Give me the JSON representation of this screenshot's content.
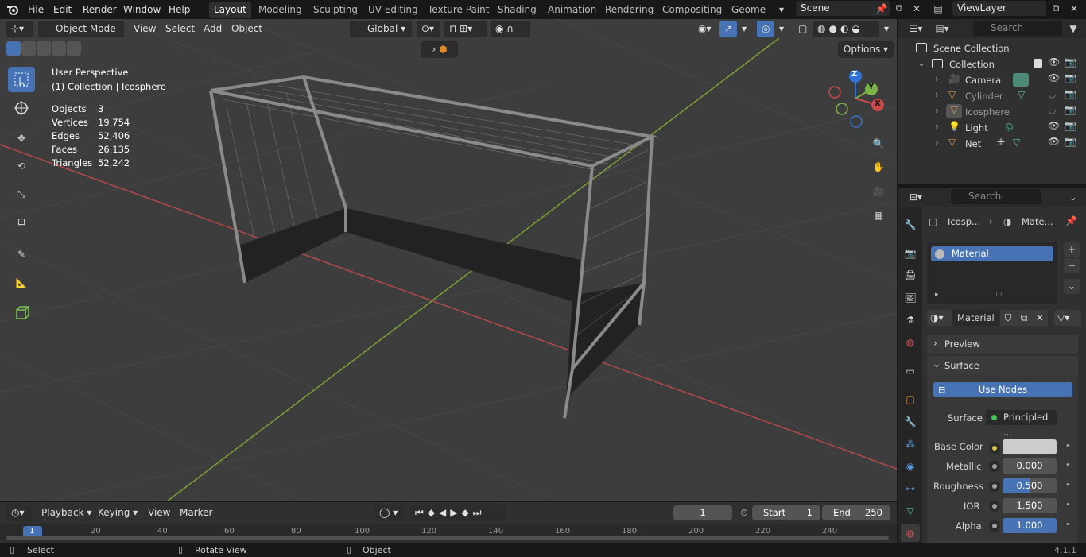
{
  "menubar": {
    "items": [
      "File",
      "Edit",
      "Render",
      "Window",
      "Help"
    ],
    "workspaces": [
      "Layout",
      "Modeling",
      "Sculpting",
      "UV Editing",
      "Texture Paint",
      "Shading",
      "Animation",
      "Rendering",
      "Compositing",
      "Geomet"
    ],
    "active_workspace": "Layout",
    "scene": "Scene",
    "view_layer": "ViewLayer"
  },
  "viewport": {
    "mode": "Object Mode",
    "menus": [
      "View",
      "Select",
      "Add",
      "Object"
    ],
    "orientation": "Global",
    "options": "Options",
    "view_name": "User Perspective",
    "context": "(1) Collection | Icosphere",
    "stats": [
      {
        "label": "Objects",
        "value": "3"
      },
      {
        "label": "Vertices",
        "value": "19,754"
      },
      {
        "label": "Edges",
        "value": "52,406"
      },
      {
        "label": "Faces",
        "value": "26,135"
      },
      {
        "label": "Triangles",
        "value": "52,242"
      }
    ],
    "gizmo": {
      "x": "X",
      "y": "Y",
      "z": "Z"
    }
  },
  "outliner": {
    "search_placeholder": "Search",
    "scene_collection": "Scene Collection",
    "collection": "Collection",
    "items": [
      {
        "name": "Camera",
        "color": "#e09a4b"
      },
      {
        "name": "Cylinder",
        "color": "#e09a4b"
      },
      {
        "name": "Icosphere",
        "color": "#e09a4b"
      },
      {
        "name": "Light",
        "color": "#e09a4b"
      },
      {
        "name": "Net",
        "color": "#e09a4b"
      }
    ]
  },
  "properties": {
    "search_placeholder": "Search",
    "breadcrumb_object": "Icosp...",
    "breadcrumb_material": "Mate...",
    "slot": "Material",
    "material_name": "Material",
    "preview": "Preview",
    "surface_section": "Surface",
    "use_nodes": "Use Nodes",
    "surface_label": "Surface",
    "surface_value": "Principled ...",
    "fields": [
      {
        "label": "Base Color",
        "value": ""
      },
      {
        "label": "Metallic",
        "value": "0.000"
      },
      {
        "label": "Roughness",
        "value": "0.500"
      },
      {
        "label": "IOR",
        "value": "1.500"
      },
      {
        "label": "Alpha",
        "value": "1.000"
      }
    ]
  },
  "timeline": {
    "menus": [
      "Playback",
      "Keying",
      "View",
      "Marker"
    ],
    "current_frame": "1",
    "start_label": "Start",
    "start": "1",
    "end_label": "End",
    "end": "250",
    "ticks": [
      "1",
      "20",
      "40",
      "60",
      "80",
      "100",
      "120",
      "140",
      "160",
      "180",
      "200",
      "220",
      "240"
    ]
  },
  "statusbar": {
    "select": "Select",
    "rotate": "Rotate View",
    "object": "Object",
    "version": "4.1.1"
  },
  "colors": {
    "accent": "#4772b3",
    "x_axis": "#c84a4a",
    "y_axis": "#7cb347",
    "z_axis": "#2f73d8"
  }
}
